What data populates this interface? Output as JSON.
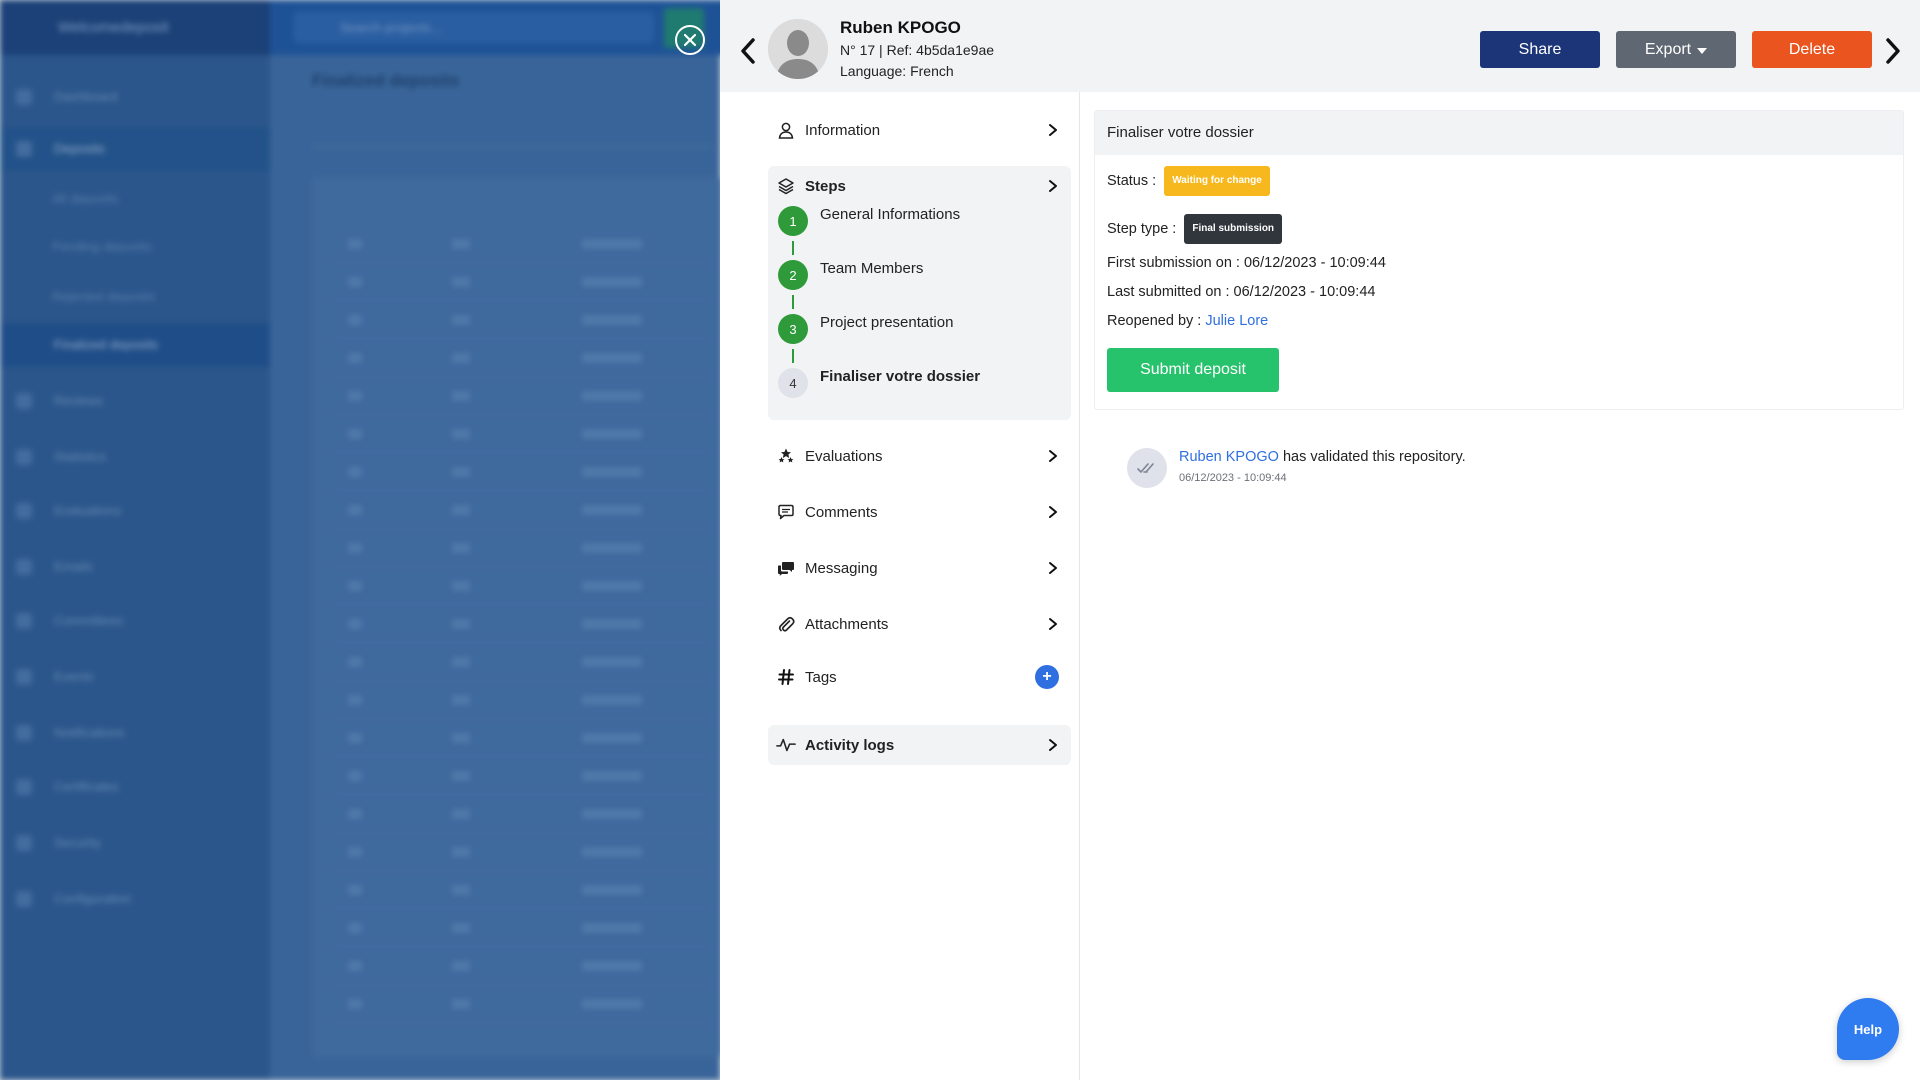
{
  "background_app": {
    "brand": "Welcomedeposit",
    "search_placeholder": "Search projects...",
    "page_title": "Finalized deposits",
    "sidebar_items": [
      "Dashboard",
      "Deposits",
      "All deposits",
      "Pending deposits",
      "Rejected deposits",
      "Finalized deposits",
      "Reviews",
      "Statistics",
      "Evaluations",
      "Emails",
      "Committees",
      "Events",
      "Notifications",
      "Certificates",
      "Security",
      "Configuration"
    ]
  },
  "colors": {
    "primary_dark": "#1c3578",
    "export": "#5f6772",
    "danger": "#ea541f",
    "success": "#2e9a3a",
    "submit": "#27c26c",
    "status_waiting": "#f7b81e",
    "link": "#2f6fe0"
  },
  "icons": {
    "close": "close-circle-icon",
    "prev": "chevron-left-icon",
    "next": "chevron-right-icon",
    "avatar": "user-silhouette-icon",
    "information": "user-icon",
    "steps": "layers-icon",
    "evaluations": "stars-icon",
    "comments": "comment-icon",
    "messaging": "messages-icon",
    "attachments": "paperclip-icon",
    "tags": "hashtag-icon",
    "activity_logs": "pulse-icon",
    "validated": "double-check-icon"
  },
  "header": {
    "name": "Ruben KPOGO",
    "ref_line": "N° 17 | Ref: 4b5da1e9ae",
    "language_line": "Language: French",
    "share_label": "Share",
    "export_label": "Export",
    "delete_label": "Delete"
  },
  "menu": {
    "information": "Information",
    "steps": "Steps",
    "evaluations": "Evaluations",
    "comments": "Comments",
    "messaging": "Messaging",
    "attachments": "Attachments",
    "tags": "Tags",
    "tags_add": "+",
    "activity_logs": "Activity logs"
  },
  "steps": [
    {
      "num": "1",
      "label": "General Informations",
      "state": "done"
    },
    {
      "num": "2",
      "label": "Team Members",
      "state": "done"
    },
    {
      "num": "3",
      "label": "Project presentation",
      "state": "done"
    },
    {
      "num": "4",
      "label": "Finaliser votre dossier",
      "state": "current"
    }
  ],
  "step_detail": {
    "title": "Finaliser votre dossier",
    "status_label": "Status :",
    "status_value": "Waiting for change",
    "step_type_label": "Step type :",
    "step_type_value": "Final submission",
    "first_submission": "First submission on : 06/12/2023 - 10:09:44",
    "last_submitted": "Last submitted on : 06/12/2023 - 10:09:44",
    "reopened_label": "Reopened by :",
    "reopened_by": "Julie Lore",
    "submit_label": "Submit deposit"
  },
  "activity": {
    "actor": "Ruben KPOGO",
    "message": "has validated this repository.",
    "date": "06/12/2023 - 10:09:44"
  },
  "help_label": "Help"
}
